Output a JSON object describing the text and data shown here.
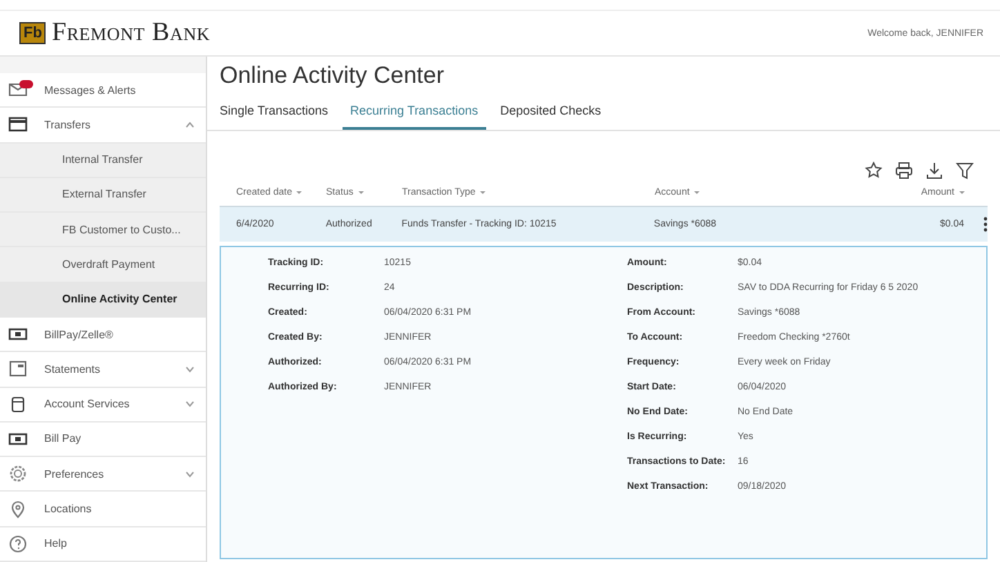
{
  "header": {
    "logo_mark": "Fb",
    "logo_text": "Fremont Bank",
    "welcome": "Welcome back, JENNIFER"
  },
  "sidebar": {
    "items": [
      {
        "label": "Messages & Alerts",
        "unread": true,
        "selected": false
      },
      {
        "label": "Transfers",
        "expanded": true,
        "selected": false,
        "children": [
          {
            "label": "Internal Transfer",
            "selected": false
          },
          {
            "label": "External Transfer",
            "selected": false
          },
          {
            "label": "FB Customer to Custo...",
            "selected": false
          },
          {
            "label": "Overdraft Payment",
            "selected": false
          },
          {
            "label": "Online Activity Center",
            "selected": true
          }
        ]
      },
      {
        "label": "BillPay/Zelle®",
        "selected": false
      },
      {
        "label": "Statements",
        "expanded": false,
        "selected": false
      },
      {
        "label": "Account Services",
        "expanded": false,
        "selected": false
      },
      {
        "label": "Bill Pay",
        "selected": false
      },
      {
        "label": "Preferences",
        "expanded": false,
        "selected": false
      },
      {
        "label": "Locations",
        "selected": false
      },
      {
        "label": "Help",
        "selected": false
      }
    ]
  },
  "page": {
    "title": "Online Activity Center"
  },
  "tabs": [
    {
      "label": "Single Transactions",
      "selected": false
    },
    {
      "label": "Recurring Transactions",
      "selected": true
    },
    {
      "label": "Deposited Checks",
      "selected": false
    }
  ],
  "table": {
    "columns": [
      "Created date",
      "Status",
      "Transaction Type",
      "Account",
      "Amount"
    ],
    "rows": [
      {
        "cells": [
          "6/4/2020",
          "Authorized",
          "Funds Transfer - Tracking ID: 10215",
          "Savings *6088",
          "$0.04"
        ],
        "expanded": true
      }
    ]
  },
  "details": {
    "left": [
      {
        "label": "Tracking ID:",
        "value": "10215"
      },
      {
        "label": "Recurring ID:",
        "value": "24"
      },
      {
        "label": "Created:",
        "value": "06/04/2020 6:31 PM"
      },
      {
        "label": "Created By:",
        "value": "JENNIFER"
      },
      {
        "label": "Authorized:",
        "value": "06/04/2020 6:31 PM"
      },
      {
        "label": "Authorized By:",
        "value": "JENNIFER"
      }
    ],
    "right": [
      {
        "label": "Amount:",
        "value": "$0.04"
      },
      {
        "label": "Description:",
        "value": "SAV to DDA Recurring for Friday 6 5 2020"
      },
      {
        "label": "From Account:",
        "value": "Savings *6088"
      },
      {
        "label": "To Account:",
        "value": "Freedom Checking *2760t"
      },
      {
        "label": "Frequency:",
        "value": "Every week on Friday"
      },
      {
        "label": "Start Date:",
        "value": "06/04/2020"
      },
      {
        "label": "No End Date:",
        "value": "No End Date"
      },
      {
        "label": "Is Recurring:",
        "value": "Yes"
      },
      {
        "label": "Transactions to Date:",
        "value": "16"
      },
      {
        "label": "Next Transaction:",
        "value": "09/18/2020"
      }
    ]
  }
}
